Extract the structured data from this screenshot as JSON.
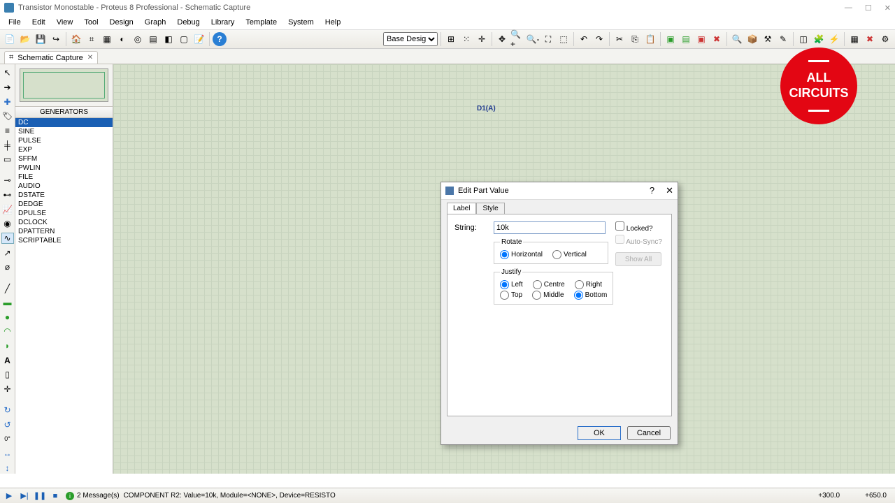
{
  "title": "Transistor Monostable - Proteus 8 Professional - Schematic Capture",
  "menu": [
    "File",
    "Edit",
    "View",
    "Tool",
    "Design",
    "Graph",
    "Debug",
    "Library",
    "Template",
    "System",
    "Help"
  ],
  "design_selector": "Base Design",
  "doctab": {
    "label": "Schematic Capture"
  },
  "side_panel": {
    "title": "GENERATORS",
    "items": [
      "DC",
      "SINE",
      "PULSE",
      "EXP",
      "SFFM",
      "PWLIN",
      "FILE",
      "AUDIO",
      "DSTATE",
      "DEDGE",
      "DPULSE",
      "DCLOCK",
      "DPATTERN",
      "SCRIPTABLE"
    ],
    "selected": 0
  },
  "canvas": {
    "label": "D1(A)"
  },
  "dialog": {
    "title": "Edit Part Value",
    "tabs": [
      "Label",
      "Style"
    ],
    "active_tab": 0,
    "string_label": "String:",
    "string_value": "10k",
    "rotate": {
      "legend": "Rotate",
      "options": [
        "Horizontal",
        "Vertical"
      ],
      "selected": 0
    },
    "justify": {
      "legend": "Justify",
      "row1": [
        "Left",
        "Centre",
        "Right"
      ],
      "row1_sel": 0,
      "row2": [
        "Top",
        "Middle",
        "Bottom"
      ],
      "row2_sel": 2
    },
    "locked_label": "Locked?",
    "autosync_label": "Auto-Sync?",
    "show_all": "Show All",
    "ok": "OK",
    "cancel": "Cancel"
  },
  "statusbar": {
    "messages": "2 Message(s)",
    "component": "COMPONENT R2: Value=10k, Module=<NONE>, Device=RESISTO",
    "coord1": "+300.0",
    "coord2": "+650.0"
  },
  "badge": "ALL\nCIRCUITS"
}
